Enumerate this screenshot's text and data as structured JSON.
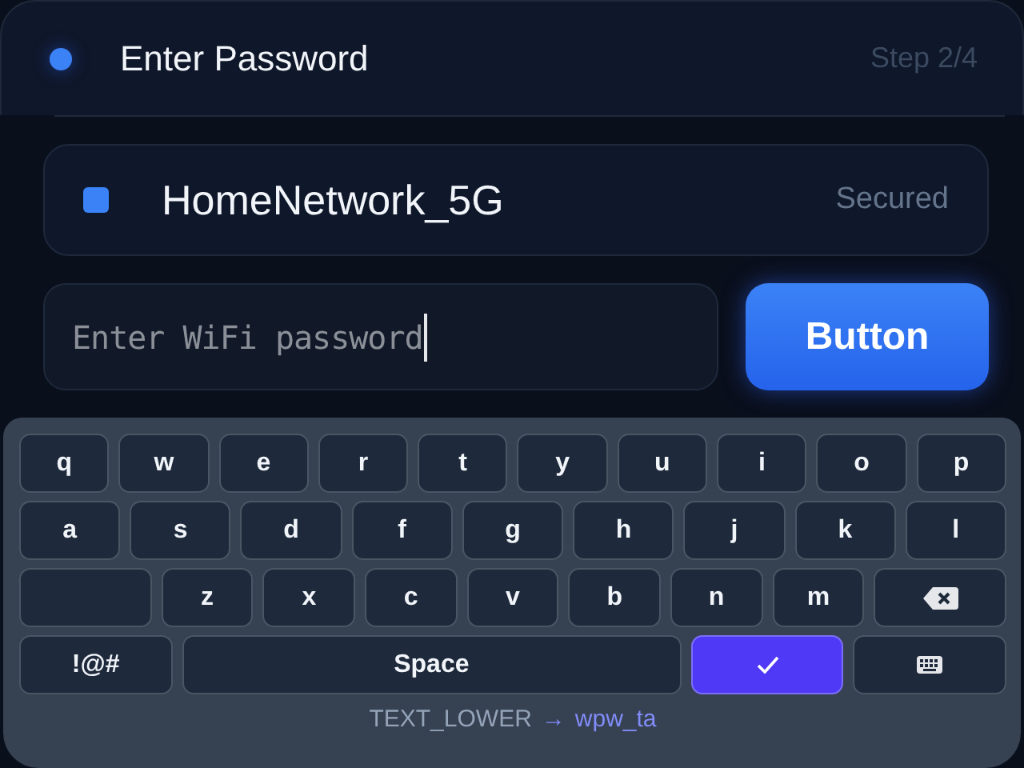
{
  "header": {
    "title": "Enter Password",
    "step": "Step 2/4"
  },
  "network": {
    "name": "HomeNetwork_5G",
    "status": "Secured"
  },
  "password": {
    "placeholder": "Enter WiFi password",
    "focused": true
  },
  "submit": {
    "label": "Button"
  },
  "keyboard": {
    "rows": [
      {
        "keys": [
          {
            "kind": "char",
            "label": "q"
          },
          {
            "kind": "char",
            "label": "w"
          },
          {
            "kind": "char",
            "label": "e"
          },
          {
            "kind": "char",
            "label": "r"
          },
          {
            "kind": "char",
            "label": "t"
          },
          {
            "kind": "char",
            "label": "y"
          },
          {
            "kind": "char",
            "label": "u"
          },
          {
            "kind": "char",
            "label": "i"
          },
          {
            "kind": "char",
            "label": "o"
          },
          {
            "kind": "char",
            "label": "p"
          }
        ]
      },
      {
        "keys": [
          {
            "kind": "char",
            "label": "a"
          },
          {
            "kind": "char",
            "label": "s"
          },
          {
            "kind": "char",
            "label": "d"
          },
          {
            "kind": "char",
            "label": "f"
          },
          {
            "kind": "char",
            "label": "g"
          },
          {
            "kind": "char",
            "label": "h"
          },
          {
            "kind": "char",
            "label": "j"
          },
          {
            "kind": "char",
            "label": "k"
          },
          {
            "kind": "char",
            "label": "l"
          }
        ]
      },
      {
        "keys": [
          {
            "kind": "blank"
          },
          {
            "kind": "char",
            "label": "z"
          },
          {
            "kind": "char",
            "label": "x"
          },
          {
            "kind": "char",
            "label": "c"
          },
          {
            "kind": "char",
            "label": "v"
          },
          {
            "kind": "char",
            "label": "b"
          },
          {
            "kind": "char",
            "label": "n"
          },
          {
            "kind": "char",
            "label": "m"
          },
          {
            "kind": "backspace"
          }
        ]
      },
      {
        "keys": [
          {
            "kind": "symbols",
            "label": "!@#"
          },
          {
            "kind": "space",
            "label": "Space"
          },
          {
            "kind": "enter"
          },
          {
            "kind": "hide"
          }
        ]
      }
    ],
    "mode": "TEXT_LOWER",
    "arrow": "→",
    "target": "wpw_ta"
  }
}
